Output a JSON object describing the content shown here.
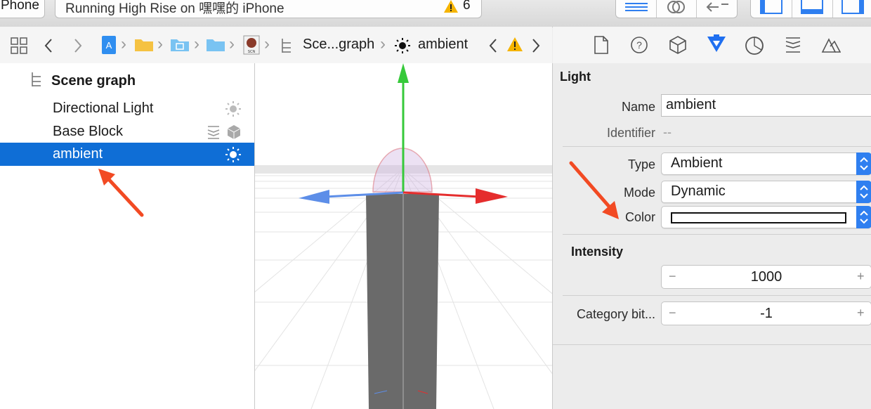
{
  "toolbar": {
    "device_label": "Phone",
    "status_text": "Running High Rise on 嘿嘿的 iPhone",
    "warning_count": "6"
  },
  "jumpbar": {
    "crumb_scene": "Sce...graph",
    "crumb_node": "ambient"
  },
  "outline": {
    "header": "Scene graph",
    "items": [
      {
        "label": "Directional Light"
      },
      {
        "label": "Base Block"
      },
      {
        "label": "ambient"
      }
    ]
  },
  "inspector": {
    "section_light": "Light",
    "name_label": "Name",
    "name_value": "ambient",
    "identifier_label": "Identifier",
    "identifier_value": "--",
    "type_label": "Type",
    "type_value": "Ambient",
    "mode_label": "Mode",
    "mode_value": "Dynamic",
    "color_label": "Color",
    "intensity_label": "Intensity",
    "intensity_value": "1000",
    "category_label": "Category bit...",
    "category_value": "-1",
    "minus": "−",
    "plus": "+"
  },
  "colors": {
    "accent": "#0f6ed6",
    "arrow": "#f24a23",
    "warning": "#f5b400"
  }
}
